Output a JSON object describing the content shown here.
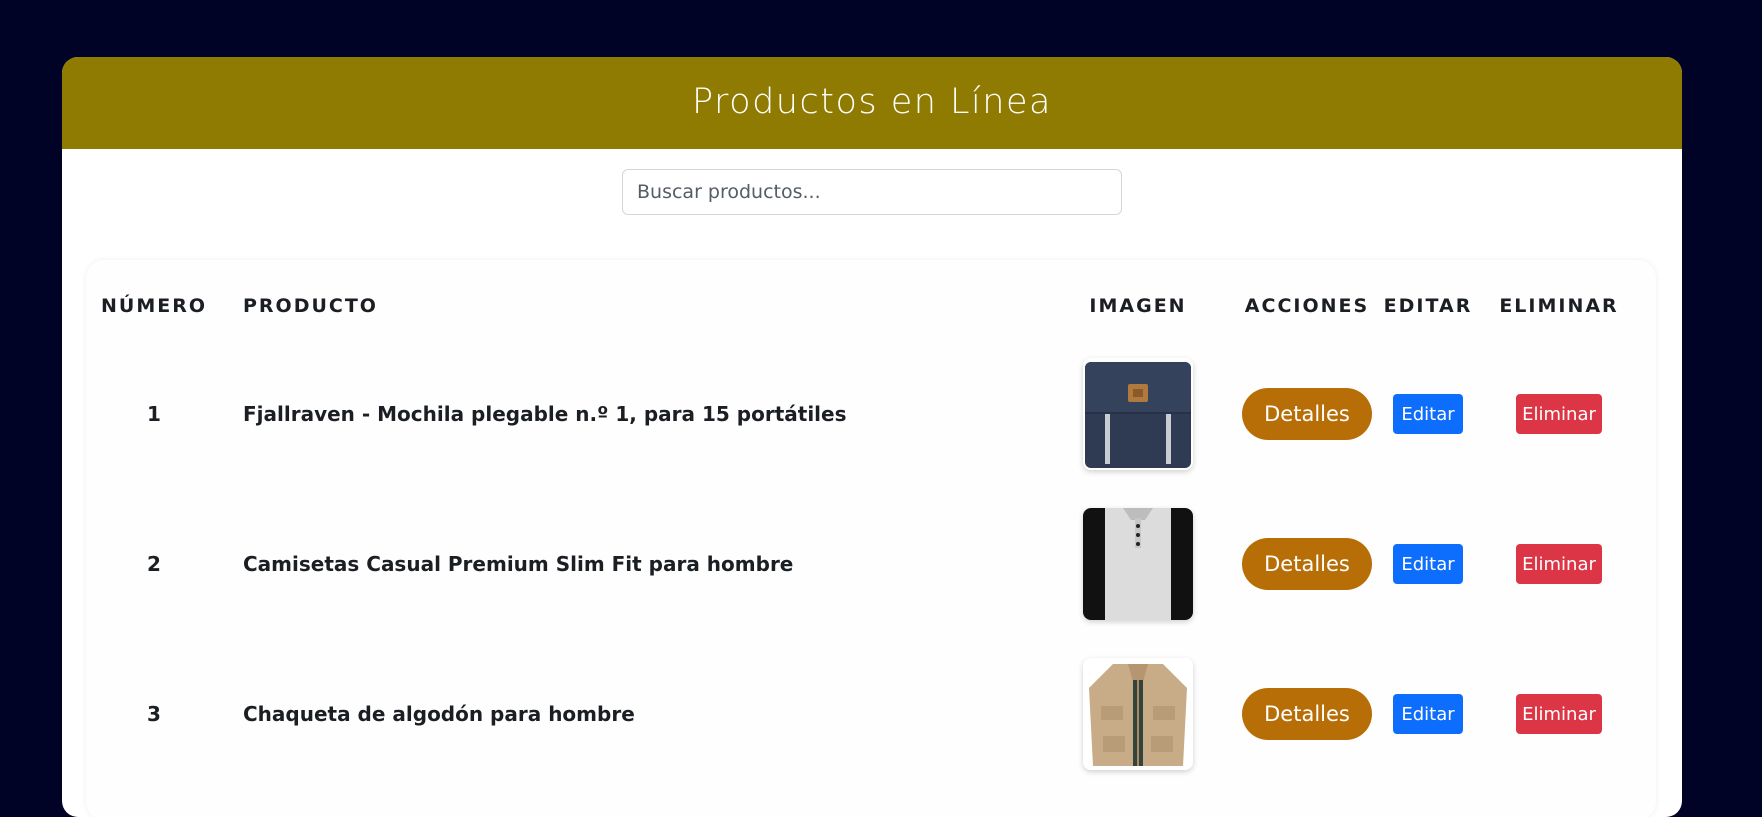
{
  "header": {
    "title": "Productos en Línea"
  },
  "search": {
    "placeholder": "Buscar productos...",
    "value": ""
  },
  "table": {
    "columns": {
      "number": "NÚMERO",
      "product": "PRODUCTO",
      "image": "IMAGEN",
      "actions": "ACCIONES",
      "edit": "EDITAR",
      "delete": "ELIMINAR"
    },
    "rows": [
      {
        "number": "1",
        "name": "Fjallraven - Mochila plegable n.º 1, para 15 portátiles",
        "image": "backpack-image",
        "details_label": "Detalles",
        "edit_label": "Editar",
        "delete_label": "Eliminar"
      },
      {
        "number": "2",
        "name": "Camisetas Casual Premium Slim Fit para hombre",
        "image": "tshirt-image",
        "details_label": "Detalles",
        "edit_label": "Editar",
        "delete_label": "Eliminar"
      },
      {
        "number": "3",
        "name": "Chaqueta de algodón para hombre",
        "image": "jacket-image",
        "details_label": "Detalles",
        "edit_label": "Editar",
        "delete_label": "Eliminar"
      }
    ]
  },
  "colors": {
    "page_background": "#010326",
    "header_background": "#8f7a02",
    "details_button": "#b76e07",
    "edit_button": "#0d6efd",
    "delete_button": "#dc3545"
  }
}
